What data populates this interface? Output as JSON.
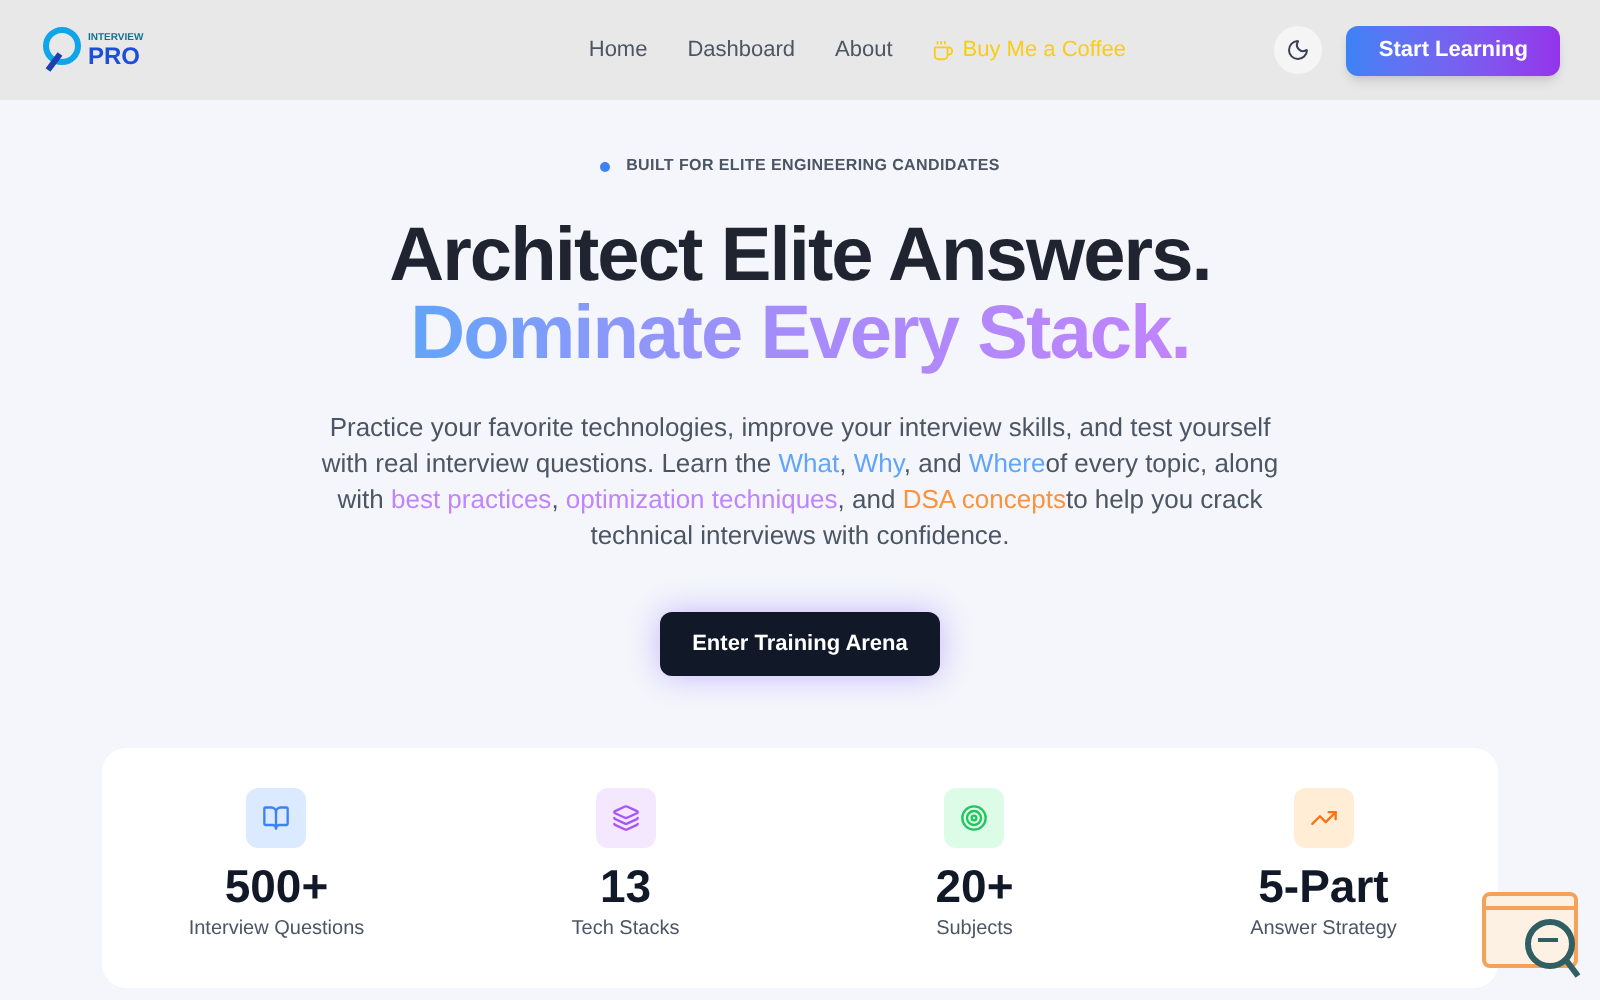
{
  "logo": {
    "top": "INTERVIEW",
    "bottom": "PRO"
  },
  "nav": [
    {
      "label": "Home",
      "kind": "plain"
    },
    {
      "label": "Dashboard",
      "kind": "plain"
    },
    {
      "label": "About",
      "kind": "plain"
    },
    {
      "label": "Buy Me a Coffee",
      "kind": "coffee"
    }
  ],
  "cta": "Start Learning",
  "badge": "BUILT FOR ELITE ENGINEERING CANDIDATES",
  "headline": [
    "Architect Elite Answers.",
    "Dominate Every Stack."
  ],
  "intro": [
    {
      "text": "Practice your favorite technologies, improve your interview skills, and test yourself with real interview questions. Learn the ",
      "kind": "plain"
    },
    {
      "text": "What",
      "kind": "blue"
    },
    {
      "text": ", ",
      "kind": "plain"
    },
    {
      "text": "Why",
      "kind": "blue"
    },
    {
      "text": ", and ",
      "kind": "plain"
    },
    {
      "text": "Where",
      "kind": "blue"
    },
    {
      "text": "of every topic, along with ",
      "kind": "plain"
    },
    {
      "text": "best practices",
      "kind": "purple"
    },
    {
      "text": ", ",
      "kind": "plain"
    },
    {
      "text": "optimization techniques",
      "kind": "purple"
    },
    {
      "text": ", and ",
      "kind": "plain"
    },
    {
      "text": "DSA concepts",
      "kind": "orange"
    },
    {
      "text": "to help you crack technical interviews with confidence.",
      "kind": "plain"
    }
  ],
  "enter": "Enter Training Arena",
  "stats": [
    {
      "value": "500+",
      "label": "Interview Questions",
      "kind": "book"
    },
    {
      "value": "13",
      "label": "Tech Stacks",
      "kind": "layers"
    },
    {
      "value": "20+",
      "label": "Subjects",
      "kind": "target"
    },
    {
      "value": "5-Part",
      "label": "Answer Strategy",
      "kind": "trend"
    }
  ]
}
